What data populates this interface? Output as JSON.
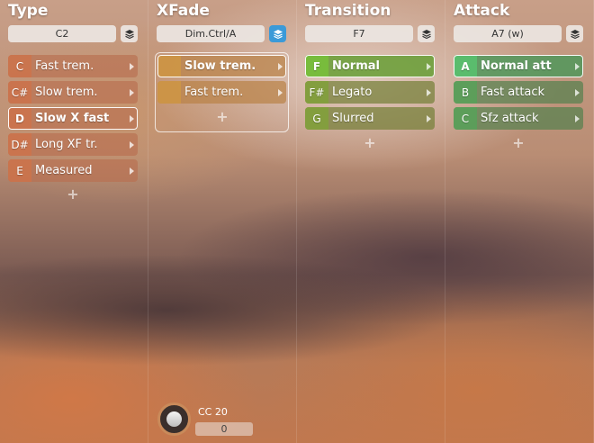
{
  "columns": [
    {
      "title": "Type",
      "selector": "C2",
      "items": [
        {
          "key": "C",
          "label": "Fast trem."
        },
        {
          "key": "C#",
          "label": "Slow trem."
        },
        {
          "key": "D",
          "label": "Slow X fast"
        },
        {
          "key": "D#",
          "label": "Long XF tr."
        },
        {
          "key": "E",
          "label": "Measured"
        }
      ]
    },
    {
      "title": "XFade",
      "selector": "Dim.Ctrl/A",
      "items": [
        {
          "key": "",
          "label": "Slow trem."
        },
        {
          "key": "",
          "label": "Fast trem."
        }
      ]
    },
    {
      "title": "Transition",
      "selector": "F7",
      "items": [
        {
          "key": "F",
          "label": "Normal"
        },
        {
          "key": "F#",
          "label": "Legato"
        },
        {
          "key": "G",
          "label": "Slurred"
        }
      ]
    },
    {
      "title": "Attack",
      "selector": "A7 (w)",
      "items": [
        {
          "key": "A",
          "label": "Normal att"
        },
        {
          "key": "B",
          "label": "Fast attack"
        },
        {
          "key": "C",
          "label": "Sfz attack"
        }
      ]
    }
  ],
  "plus_symbol": "+",
  "controller": {
    "label": "CC 20",
    "value": "0"
  },
  "icons": {
    "layer": "layers-icon",
    "arrow": "triangle-right-icon",
    "add": "plus-icon",
    "knob": "knob-icon"
  },
  "colors": {
    "active_layer_button": "#3b9ad8",
    "type": "#cd734b",
    "xfade": "#cd9646",
    "transition": "#82a03c",
    "attack": "#5aa05a"
  }
}
